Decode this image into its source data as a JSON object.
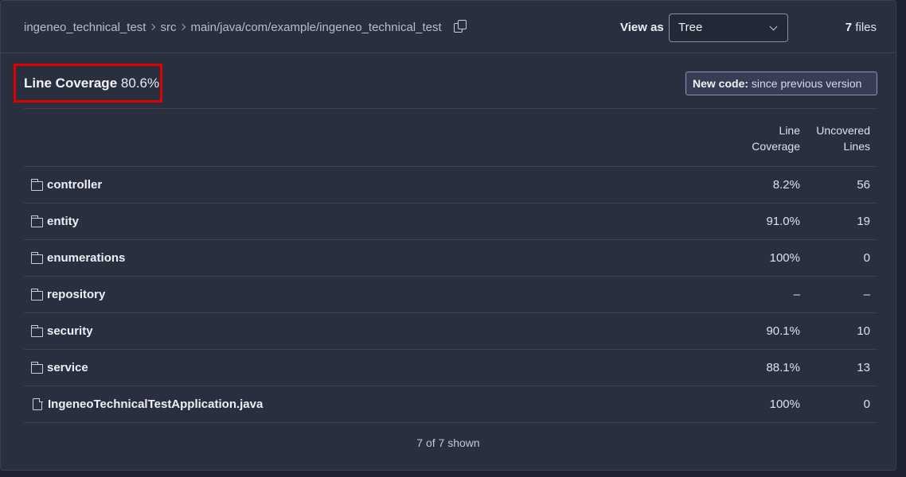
{
  "breadcrumb": {
    "items": [
      "ingeneo_technical_test",
      "src",
      "main/java/com/example/ingeneo_technical_test"
    ]
  },
  "header": {
    "view_as_label": "View as",
    "view_select": {
      "selected": "Tree"
    },
    "files_count": "7",
    "files_label": "files"
  },
  "metric": {
    "label": "Line Coverage",
    "value": "80.6%"
  },
  "new_code": {
    "label": "New code:",
    "text": "since previous version"
  },
  "table": {
    "columns": {
      "coverage": [
        "Line",
        "Coverage"
      ],
      "uncovered": [
        "Uncovered",
        "Lines"
      ]
    },
    "rows": [
      {
        "icon": "folder-icon",
        "name": "controller",
        "coverage": "8.2%",
        "uncovered": "56"
      },
      {
        "icon": "folder-icon",
        "name": "entity",
        "coverage": "91.0%",
        "uncovered": "19"
      },
      {
        "icon": "folder-icon",
        "name": "enumerations",
        "coverage": "100%",
        "uncovered": "0"
      },
      {
        "icon": "folder-icon",
        "name": "repository",
        "coverage": "–",
        "uncovered": "–"
      },
      {
        "icon": "folder-icon",
        "name": "security",
        "coverage": "90.1%",
        "uncovered": "10"
      },
      {
        "icon": "folder-icon",
        "name": "service",
        "coverage": "88.1%",
        "uncovered": "13"
      },
      {
        "icon": "file-icon",
        "name": "IngeneoTechnicalTestApplication.java",
        "coverage": "100%",
        "uncovered": "0"
      }
    ]
  },
  "footer": {
    "shown_text": "7 of 7 shown"
  },
  "colors": {
    "background": "#1f2231",
    "panel": "#2a2f40",
    "highlight_box": "#e00000",
    "new_code_badge": "#363d55"
  }
}
